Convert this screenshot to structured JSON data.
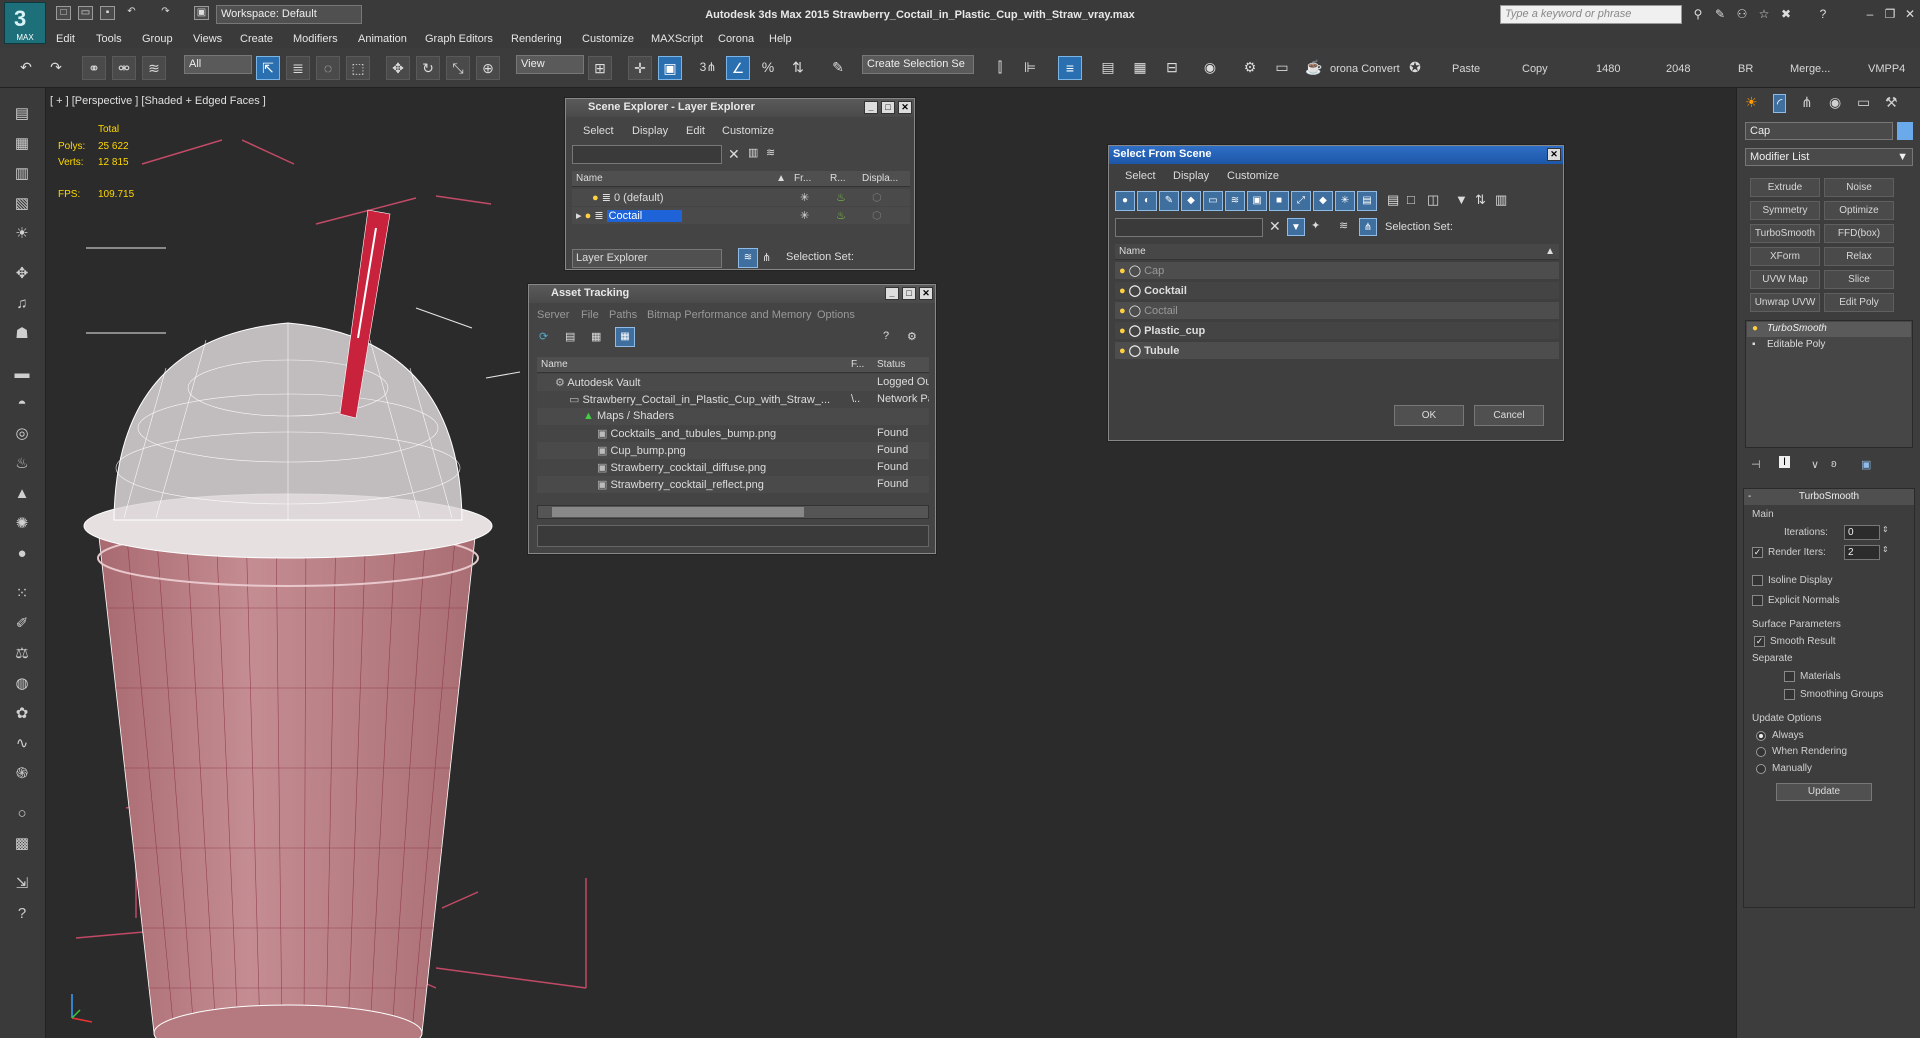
{
  "app": {
    "logo": "MAX",
    "workspace": "Workspace: Default",
    "title": "Autodesk 3ds Max  2015    Strawberry_Coctail_in_Plastic_Cup_with_Straw_vray.max",
    "search_placeholder": "Type a keyword or phrase"
  },
  "menus": [
    "Edit",
    "Tools",
    "Group",
    "Views",
    "Create",
    "Modifiers",
    "Animation",
    "Graph Editors",
    "Rendering",
    "Customize",
    "MAXScript",
    "Corona",
    "Help"
  ],
  "toolbar": {
    "filter": "All",
    "refcoord": "View",
    "named_sel": "Create Selection Se",
    "angle_snap": "3",
    "labels": {
      "corona": "orona Convert",
      "paste": "Paste",
      "copy": "Copy",
      "w1480": "1480",
      "w2048": "2048",
      "br": "BR",
      "merge": "Merge...",
      "vmpp": "VMPP4"
    }
  },
  "viewport": {
    "label": "[ + ] [Perspective ] [Shaded + Edged Faces ]",
    "total": "Total",
    "polys_label": "Polys:",
    "polys": "25 622",
    "verts_label": "Verts:",
    "verts": "12 815",
    "fps_label": "FPS:",
    "fps": "109.715"
  },
  "scene_explorer": {
    "title": "Scene Explorer - Layer Explorer",
    "menus": [
      "Select",
      "Display",
      "Edit",
      "Customize"
    ],
    "columns": [
      "Name",
      "Fr...",
      "R...",
      "Displa..."
    ],
    "rows": [
      {
        "name": "0 (default)",
        "selected": false
      },
      {
        "name": "Coctail",
        "selected": true
      }
    ],
    "footer_dropdown": "Layer Explorer",
    "selection_set": "Selection Set:"
  },
  "asset_tracking": {
    "title": "Asset Tracking",
    "menus": [
      "Server",
      "File",
      "Paths",
      "Bitmap Performance and Memory",
      "Options"
    ],
    "columns": [
      "Name",
      "F...",
      "Status"
    ],
    "rows": [
      {
        "name": "Autodesk Vault",
        "f": "",
        "status": "Logged Out",
        "indent": 0
      },
      {
        "name": "Strawberry_Coctail_in_Plastic_Cup_with_Straw_...",
        "f": "\\..",
        "status": "Network Pa",
        "indent": 1
      },
      {
        "name": "Maps / Shaders",
        "f": "",
        "status": "",
        "indent": 2
      },
      {
        "name": "Cocktails_and_tubules_bump.png",
        "f": "",
        "status": "Found",
        "indent": 3
      },
      {
        "name": "Cup_bump.png",
        "f": "",
        "status": "Found",
        "indent": 3
      },
      {
        "name": "Strawberry_cocktail_diffuse.png",
        "f": "",
        "status": "Found",
        "indent": 3
      },
      {
        "name": "Strawberry_cocktail_reflect.png",
        "f": "",
        "status": "Found",
        "indent": 3
      }
    ]
  },
  "select_from_scene": {
    "title": "Select From Scene",
    "menus": [
      "Select",
      "Display",
      "Customize"
    ],
    "selection_set": "Selection Set:",
    "column": "Name",
    "rows": [
      {
        "name": "Cap",
        "dim": true
      },
      {
        "name": "Cocktail",
        "dim": false
      },
      {
        "name": "Coctail",
        "dim": true
      },
      {
        "name": "Plastic_cup",
        "dim": false
      },
      {
        "name": "Tubule",
        "dim": false
      }
    ],
    "ok": "OK",
    "cancel": "Cancel"
  },
  "command_panel": {
    "object_name": "Cap",
    "modifier_list": "Modifier List",
    "buttons": [
      "Extrude",
      "Noise",
      "Symmetry",
      "Optimize",
      "TurboSmooth",
      "FFD(box)",
      "XForm",
      "Relax",
      "UVW Map",
      "Slice",
      "Unwrap UVW",
      "Edit Poly"
    ],
    "stack": [
      "TurboSmooth",
      "Editable Poly"
    ],
    "rollout": "TurboSmooth",
    "main": "Main",
    "iterations_label": "Iterations:",
    "iterations": "0",
    "render_iters_label": "Render Iters:",
    "render_iters": "2",
    "isoline": "Isoline Display",
    "explicit": "Explicit Normals",
    "surface_params": "Surface Parameters",
    "smooth_result": "Smooth Result",
    "separate": "Separate",
    "materials": "Materials",
    "smoothing_groups": "Smoothing Groups",
    "update_options": "Update Options",
    "always": "Always",
    "when_rendering": "When Rendering",
    "manually": "Manually",
    "update": "Update"
  }
}
